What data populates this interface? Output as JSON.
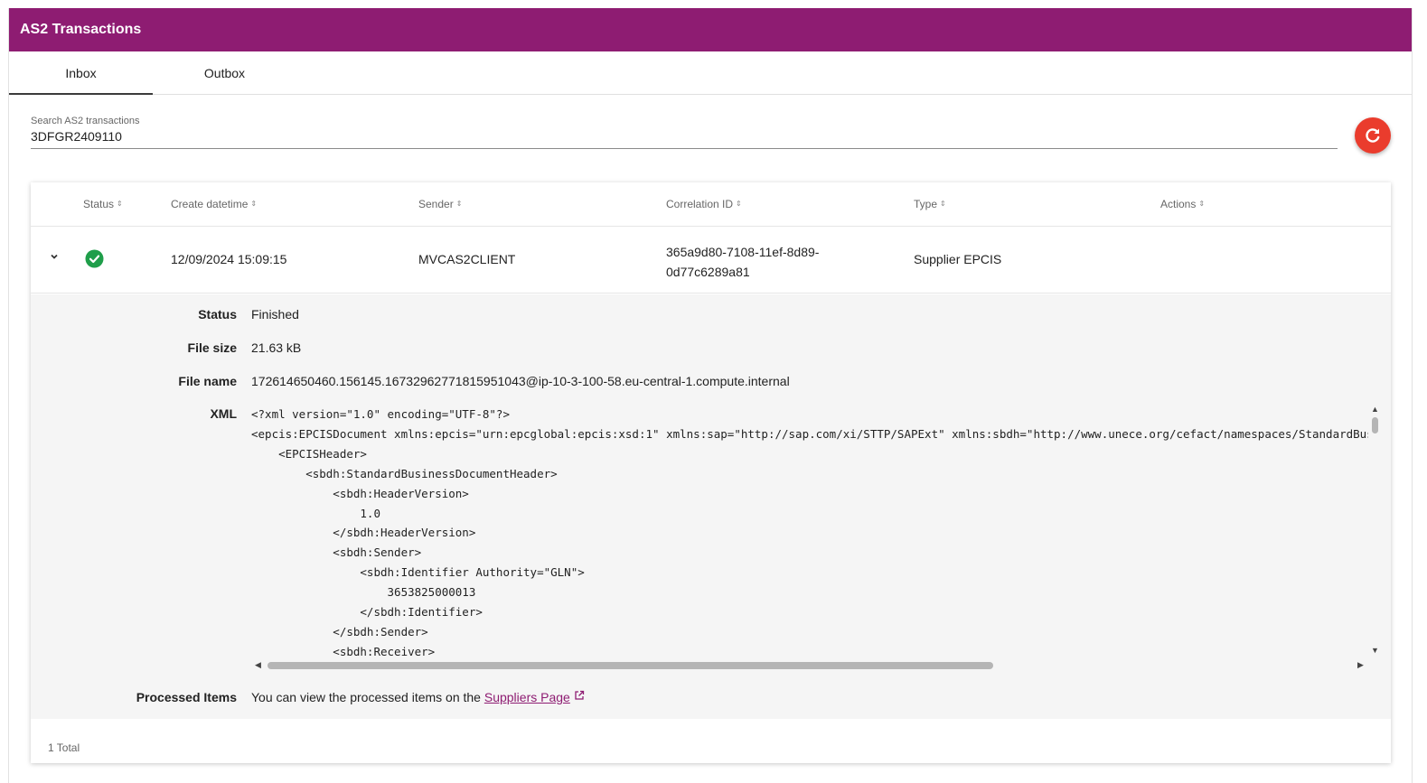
{
  "app": {
    "title": "AS2 Transactions"
  },
  "tabs": [
    {
      "label": "Inbox",
      "active": true
    },
    {
      "label": "Outbox",
      "active": false
    }
  ],
  "search": {
    "label": "Search AS2 transactions",
    "value": "3DFGR2409110"
  },
  "table": {
    "columns": [
      "Status",
      "Create datetime",
      "Sender",
      "Correlation ID",
      "Type",
      "Actions"
    ],
    "rows": [
      {
        "status_icon": "check-circle-icon",
        "create_datetime": "12/09/2024 15:09:15",
        "sender": "MVCAS2CLIENT",
        "correlation_id_line1": "365a9d80-7108-11ef-8d89-",
        "correlation_id_line2": "0d77c6289a81",
        "type": "Supplier EPCIS"
      }
    ],
    "footer_total": "1 Total"
  },
  "details": {
    "status_label": "Status",
    "status_value": "Finished",
    "filesize_label": "File size",
    "filesize_value": "21.63 kB",
    "filename_label": "File name",
    "filename_value": "172614650460.156145.16732962771815951043@ip-10-3-100-58.eu-central-1.compute.internal",
    "xml_label": "XML",
    "xml_content": "<?xml version=\"1.0\" encoding=\"UTF-8\"?>\n<epcis:EPCISDocument xmlns:epcis=\"urn:epcglobal:epcis:xsd:1\" xmlns:sap=\"http://sap.com/xi/STTP/SAPExt\" xmlns:sbdh=\"http://www.unece.org/cefact/namespaces/StandardBusinessDocumentHeader\"\n    <EPCISHeader>\n        <sbdh:StandardBusinessDocumentHeader>\n            <sbdh:HeaderVersion>\n                1.0\n            </sbdh:HeaderVersion>\n            <sbdh:Sender>\n                <sbdh:Identifier Authority=\"GLN\">\n                    3653825000013\n                </sbdh:Identifier>\n            </sbdh:Sender>\n            <sbdh:Receiver>",
    "processed_label": "Processed Items",
    "processed_text": "You can view the processed items on the",
    "processed_link": "Suppliers Page"
  },
  "colors": {
    "header_bg": "#8e1c72",
    "accent_link": "#8e1c72",
    "refresh_bg": "#ea3c2d",
    "success": "#1f9e4a"
  }
}
